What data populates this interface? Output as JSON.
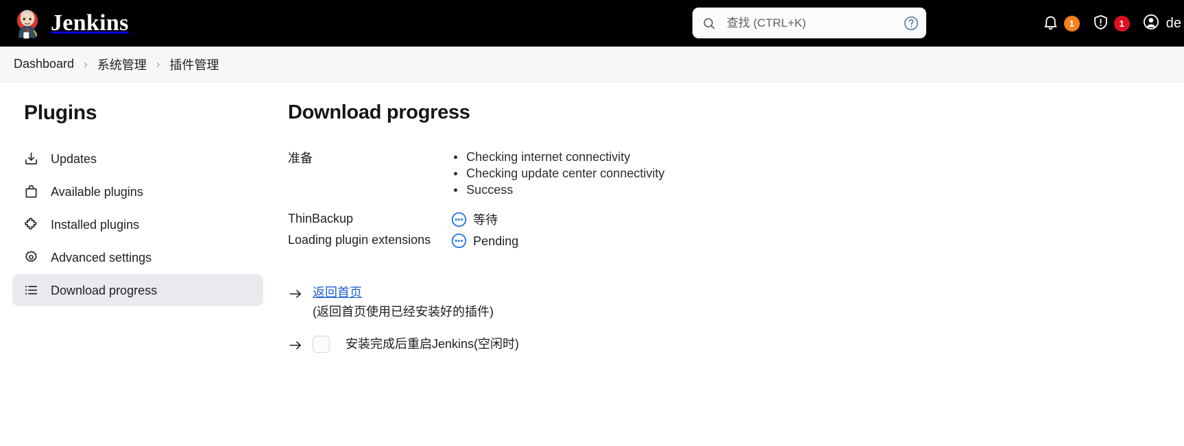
{
  "header": {
    "brand": "Jenkins",
    "brand_icon": "jenkins-butler-logo",
    "search": {
      "icon": "search-icon",
      "placeholder": "查找 (CTRL+K)",
      "value": "",
      "help_icon": "help-circle-icon"
    },
    "notifications": {
      "icon": "bell-icon",
      "count": "1",
      "badge_color": "#f5811f"
    },
    "security": {
      "icon": "shield-warning-icon",
      "count": "1",
      "badge_color": "#e01020"
    },
    "user": {
      "icon": "user-circle-icon",
      "name": "de"
    }
  },
  "breadcrumb": {
    "separator": "›",
    "items": [
      {
        "label": "Dashboard"
      },
      {
        "label": "系统管理"
      },
      {
        "label": "插件管理"
      }
    ]
  },
  "sidebar": {
    "title": "Plugins",
    "items": [
      {
        "label": "Updates",
        "icon": "download-tray-icon",
        "active": false
      },
      {
        "label": "Available plugins",
        "icon": "shopping-bag-icon",
        "active": false
      },
      {
        "label": "Installed plugins",
        "icon": "puzzle-piece-icon",
        "active": false
      },
      {
        "label": "Advanced settings",
        "icon": "gear-icon",
        "active": false
      },
      {
        "label": "Download progress",
        "icon": "list-icon",
        "active": true
      }
    ]
  },
  "main": {
    "title": "Download progress",
    "rows": [
      {
        "name": "准备",
        "status_type": "list",
        "status_items": [
          "Checking internet connectivity",
          "Checking update center connectivity",
          "Success"
        ]
      },
      {
        "name": "ThinBackup",
        "status_type": "pending",
        "status_icon": "pending-dots-icon",
        "status_text": "等待"
      },
      {
        "name": "Loading plugin extensions",
        "status_type": "pending",
        "status_icon": "pending-dots-icon",
        "status_text": "Pending"
      }
    ],
    "actions": {
      "arrow_icon": "arrow-right-icon",
      "home_link": "返回首页",
      "home_hint": "(返回首页使用已经安装好的插件)",
      "restart_checkbox_label": "安装完成后重启Jenkins(空闲时)",
      "restart_checked": false
    }
  },
  "colors": {
    "topbar_bg": "#000000",
    "accent_blue": "#1a73e8",
    "link_blue": "#1f5fd0",
    "active_nav_bg": "#e9eaee",
    "badge_orange": "#f5811f",
    "badge_red": "#e01020"
  }
}
